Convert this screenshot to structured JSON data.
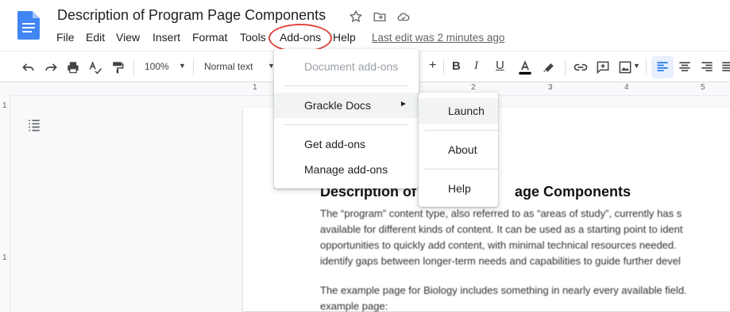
{
  "document": {
    "title": "Description of Program Page Components",
    "last_edit": "Last edit was 2 minutes ago"
  },
  "menubar": [
    "File",
    "Edit",
    "View",
    "Insert",
    "Format",
    "Tools",
    "Add-ons",
    "Help"
  ],
  "toolbar": {
    "zoom": "100%",
    "style": "Normal text"
  },
  "ruler": {
    "numbers": [
      "1",
      "1",
      "2",
      "3",
      "4",
      "5"
    ]
  },
  "addons_menu": {
    "items": [
      {
        "label": "Document add-ons",
        "disabled": true
      },
      {
        "label": "Grackle Docs",
        "has_submenu": true,
        "arrow": "►"
      },
      {
        "label": "Get add-ons"
      },
      {
        "label": "Manage add-ons"
      }
    ]
  },
  "grackle_submenu": {
    "items": [
      {
        "label": "Launch"
      },
      {
        "label": "About"
      },
      {
        "label": "Help"
      }
    ]
  },
  "body": {
    "heading_left": "Description of",
    "heading_right": "age Components",
    "lines": [
      "The “program” content type, also referred to as “areas of study”, currently has s",
      "available for different kinds of content. It can be used as a starting point to ident",
      "opportunities to quickly add content, with minimal technical resources needed.",
      "identify gaps between longer-term needs and capabilities to guide further devel",
      "",
      "The example page for Biology includes something in nearly every available field.",
      "example page:"
    ]
  },
  "colors": {
    "accent_blue": "#1a73e8",
    "highlight_circle": "#e0463f",
    "docs_blue": "#4285f4"
  }
}
